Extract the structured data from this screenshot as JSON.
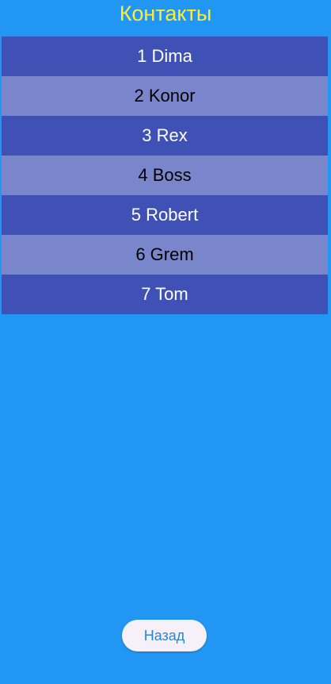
{
  "header": {
    "title": "Контакты",
    "title_color": "#FFEB3B"
  },
  "contacts": [
    {
      "label": "1 Dima",
      "style": "dark"
    },
    {
      "label": "2 Konor",
      "style": "light"
    },
    {
      "label": "3 Rex",
      "style": "dark"
    },
    {
      "label": "4 Boss",
      "style": "light"
    },
    {
      "label": "5 Robert",
      "style": "dark"
    },
    {
      "label": "6 Grem",
      "style": "light"
    },
    {
      "label": "7 Tom",
      "style": "dark"
    }
  ],
  "colors": {
    "background": "#2196F3",
    "row_dark": "#3F51B5",
    "row_light": "#7986CB",
    "button_bg": "#F6F1F9",
    "button_text": "#2D84D6"
  },
  "footer": {
    "back_label": "Назад"
  }
}
